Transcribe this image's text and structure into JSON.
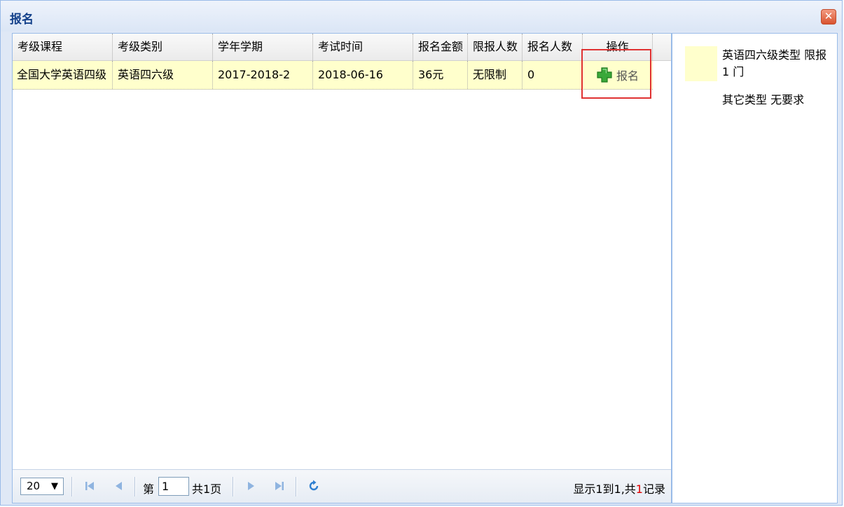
{
  "dialog": {
    "title": "报名",
    "close_label": "✕"
  },
  "grid": {
    "columns": [
      {
        "label": "考级课程"
      },
      {
        "label": "考级类别"
      },
      {
        "label": "学年学期"
      },
      {
        "label": "考试时间"
      },
      {
        "label": "报名金额"
      },
      {
        "label": "限报人数"
      },
      {
        "label": "报名人数"
      },
      {
        "label": "操作"
      }
    ],
    "rows": [
      {
        "course": "全国大学英语四级",
        "category": "英语四六级",
        "term": "2017-2018-2",
        "exam_time": "2018-06-16",
        "fee": "36元",
        "limit": "无限制",
        "enrolled": "0",
        "action_label": "报名"
      }
    ]
  },
  "pager": {
    "page_size": "20",
    "page_prefix": "第",
    "current_page": "1",
    "total_pages": "共1页",
    "records_prefix": "显示1到1,共",
    "records_count": "1",
    "records_suffix": "记录"
  },
  "legend": {
    "items": [
      {
        "text": "英语四六级类型 限报 1 门"
      },
      {
        "text": "其它类型 无要求"
      }
    ]
  },
  "colors": {
    "row_highlight": "#ffffcc",
    "title_text": "#15428b",
    "highlight_border": "#e03232"
  }
}
